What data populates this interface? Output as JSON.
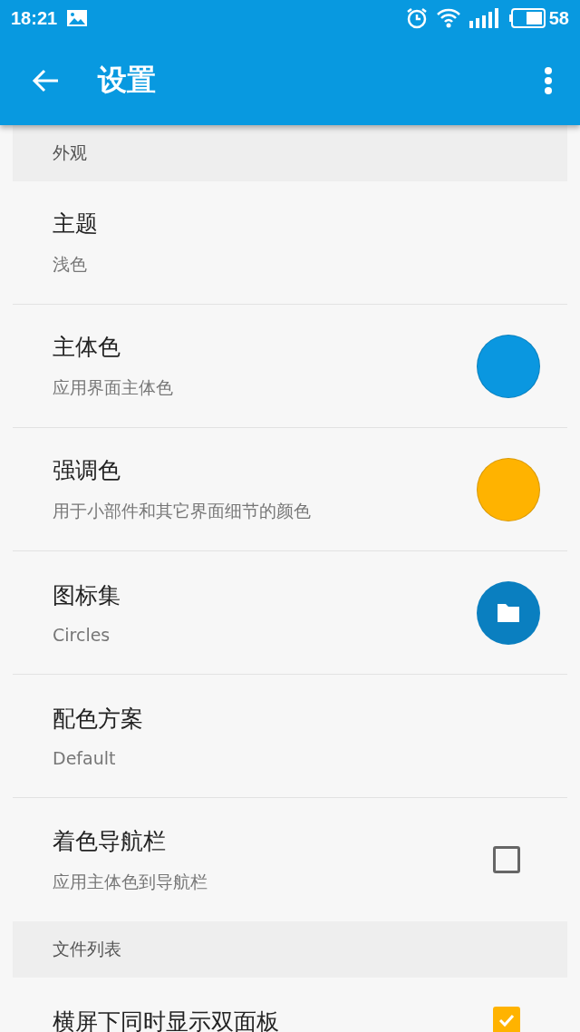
{
  "status_bar": {
    "time": "18:21",
    "battery": "58"
  },
  "app_bar": {
    "title": "设置"
  },
  "sections": [
    {
      "header": "外观",
      "items": [
        {
          "kind": "text",
          "title": "主题",
          "subtitle": "浅色"
        },
        {
          "kind": "color",
          "title": "主体色",
          "subtitle": "应用界面主体色",
          "color": "#0a97e0"
        },
        {
          "kind": "color",
          "title": "强调色",
          "subtitle": "用于小部件和其它界面细节的颜色",
          "color": "#ffb300"
        },
        {
          "kind": "icon",
          "title": "图标集",
          "subtitle": "Circles"
        },
        {
          "kind": "text",
          "title": "配色方案",
          "subtitle": "Default"
        },
        {
          "kind": "checkbox",
          "title": "着色导航栏",
          "subtitle": "应用主体色到导航栏",
          "checked": false
        }
      ]
    },
    {
      "header": "文件列表",
      "items": [
        {
          "kind": "checkbox",
          "title": "横屏下同时显示双面板",
          "checked": true
        }
      ]
    }
  ]
}
